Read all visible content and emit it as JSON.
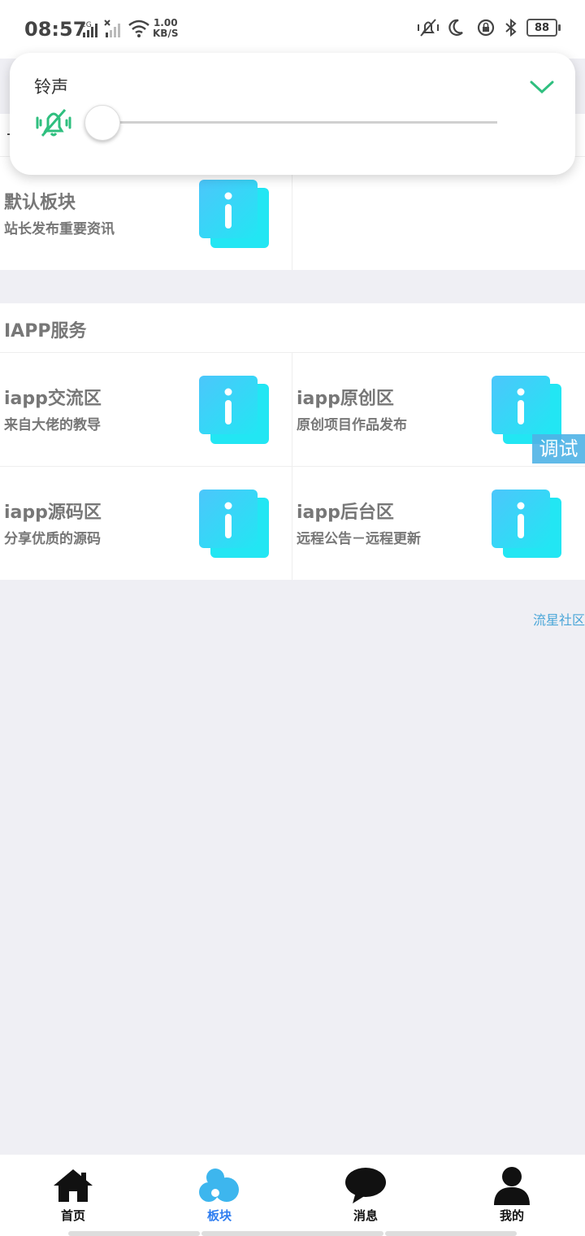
{
  "status_bar": {
    "time": "08:57",
    "net_label": "2G",
    "speed_value": "1.00",
    "speed_unit": "KB/S",
    "battery": "88"
  },
  "volume_popup": {
    "label": "铃声",
    "level": 0,
    "accent_color": "#2fbf7f"
  },
  "top_panel": {
    "board": {
      "title": "默认板块",
      "subtitle": "站长发布重要资讯"
    }
  },
  "section": {
    "title": "IAPP服务",
    "boards": [
      {
        "title": "iapp交流区",
        "subtitle": "来自大佬的教导"
      },
      {
        "title": "iapp原创区",
        "subtitle": "原创项目作品发布"
      },
      {
        "title": "iapp源码区",
        "subtitle": "分享优质的源码"
      },
      {
        "title": "iapp后台区",
        "subtitle": "远程公告－远程更新"
      }
    ]
  },
  "debug_badge": "调试",
  "footer_link": "流星社区",
  "bottom_nav": [
    {
      "label": "首页",
      "icon": "home-icon"
    },
    {
      "label": "板块",
      "icon": "blocks-icon",
      "active": true
    },
    {
      "label": "消息",
      "icon": "message-icon"
    },
    {
      "label": "我的",
      "icon": "user-icon"
    }
  ],
  "colors": {
    "icon_gradient_start": "#4fc3f7",
    "icon_gradient_end": "#1de9f6",
    "active_nav": "#2f7df0"
  }
}
